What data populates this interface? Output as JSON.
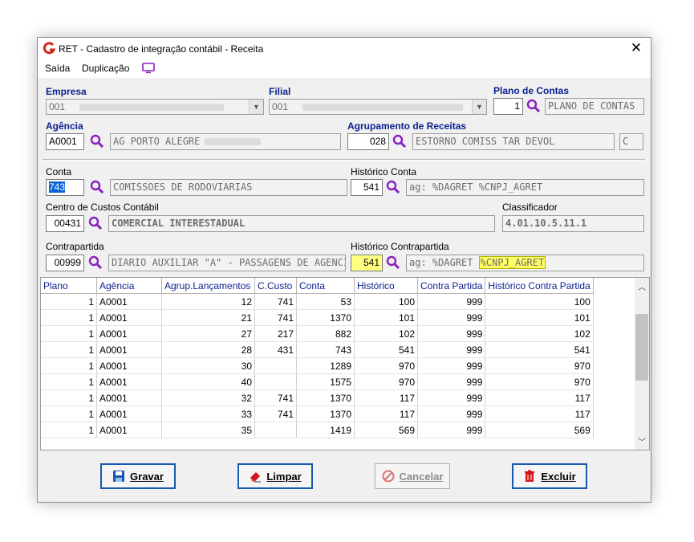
{
  "window": {
    "title": "RET - Cadastro de integração contábil - Receita",
    "close_glyph": "✕"
  },
  "menu": {
    "items": [
      "Saída",
      "Duplicação"
    ],
    "icon": "monitor-icon"
  },
  "form": {
    "empresa": {
      "label": "Empresa",
      "value": "001"
    },
    "filial": {
      "label": "Filial",
      "value": "001"
    },
    "plano_contas": {
      "label": "Plano de Contas",
      "code": "1",
      "desc": "PLANO DE CONTAS"
    },
    "agencia": {
      "label": "Agência",
      "code": "A0001",
      "desc": "AG PORTO ALEGRE"
    },
    "agrupamento": {
      "label": "Agrupamento de Receitas",
      "code": "028",
      "desc": "ESTORNO COMISS TAR DEVOL",
      "extra": "C"
    },
    "conta": {
      "label": "Conta",
      "code": "743",
      "desc": "COMISSOES DE RODOVIARIAS"
    },
    "historico_conta": {
      "label": "Histórico Conta",
      "code": "541",
      "desc": "ag: %DAGRET %CNPJ_AGRET"
    },
    "centro_custos": {
      "label": "Centro de Custos Contábil",
      "code": "00431",
      "desc": "COMERCIAL INTERESTADUAL"
    },
    "classificador": {
      "label": "Classificador",
      "value": "4.01.10.5.11.1"
    },
    "contrapartida": {
      "label": "Contrapartida",
      "code": "00999",
      "desc": "DIARIO AUXILIAR \"A\" - PASSAGENS DE AGENCIAS"
    },
    "historico_contrapartida": {
      "label": "Histórico Contrapartida",
      "code": "541",
      "desc_prefix": "ag: %DAGRET ",
      "desc_highlight": "%CNPJ_AGRET"
    }
  },
  "grid": {
    "columns": [
      "Plano",
      "Agência",
      "Agrup.Lançamentos",
      "C.Custo",
      "Conta",
      "Histórico",
      "Contra Partida",
      "Histórico Contra Partida"
    ],
    "rows": [
      [
        "1",
        "A0001",
        "12",
        "741",
        "53",
        "100",
        "999",
        "100"
      ],
      [
        "1",
        "A0001",
        "21",
        "741",
        "1370",
        "101",
        "999",
        "101"
      ],
      [
        "1",
        "A0001",
        "27",
        "217",
        "882",
        "102",
        "999",
        "102"
      ],
      [
        "1",
        "A0001",
        "28",
        "431",
        "743",
        "541",
        "999",
        "541"
      ],
      [
        "1",
        "A0001",
        "30",
        "",
        "1289",
        "970",
        "999",
        "970"
      ],
      [
        "1",
        "A0001",
        "40",
        "",
        "1575",
        "970",
        "999",
        "970"
      ],
      [
        "1",
        "A0001",
        "32",
        "741",
        "1370",
        "117",
        "999",
        "117"
      ],
      [
        "1",
        "A0001",
        "33",
        "741",
        "1370",
        "117",
        "999",
        "117"
      ],
      [
        "1",
        "A0001",
        "35",
        "",
        "1419",
        "569",
        "999",
        "569"
      ]
    ]
  },
  "buttons": {
    "gravar": "Gravar",
    "limpar": "Limpar",
    "cancelar": "Cancelar",
    "excluir": "Excluir"
  },
  "colors": {
    "label_blue": "#0a1f8f",
    "icon_purple": "#8a1fc0",
    "button_border": "#1a57b0",
    "highlight_yellow": "#ffff80"
  }
}
